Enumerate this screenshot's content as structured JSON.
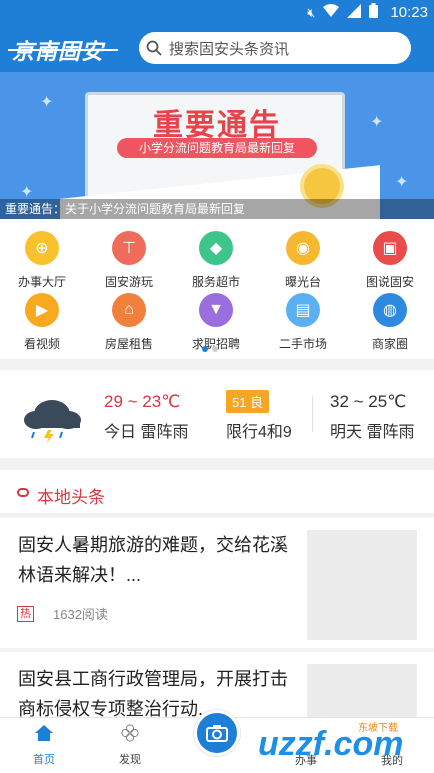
{
  "status": {
    "time": "10:23",
    "icons": [
      "mute-icon",
      "wifi-icon",
      "signal-icon",
      "battery-icon"
    ]
  },
  "header": {
    "logo": "京南固安",
    "search_placeholder": "搜索固安头条资讯"
  },
  "banner": {
    "title": "重要通告",
    "subtitle": "小学分流问题教育局最新回复",
    "caption": "重要通告：关于小学分流问题教育局最新回复"
  },
  "services": [
    {
      "label": "办事大厅",
      "icon": "compass-icon",
      "color": "#f7c22e",
      "glyph": "⊕"
    },
    {
      "label": "固安游玩",
      "icon": "signpost-icon",
      "color": "#ef6b5b",
      "glyph": "⊤"
    },
    {
      "label": "服务超市",
      "icon": "shopping-bag-icon",
      "color": "#3ec58a",
      "glyph": "◆"
    },
    {
      "label": "曝光台",
      "icon": "camera-icon",
      "color": "#f6b830",
      "glyph": "◉"
    },
    {
      "label": "图说固安",
      "icon": "picture-icon",
      "color": "#ea4c4c",
      "glyph": "▣"
    },
    {
      "label": "看视频",
      "icon": "tv-icon",
      "color": "#f8a91f",
      "glyph": "▶"
    },
    {
      "label": "房屋租售",
      "icon": "house-icon",
      "color": "#f2803d",
      "glyph": "⌂"
    },
    {
      "label": "求职招聘",
      "icon": "tie-icon",
      "color": "#9b6ee0",
      "glyph": "▼"
    },
    {
      "label": "二手市场",
      "icon": "shop-icon",
      "color": "#5ab0f2",
      "glyph": "▤"
    },
    {
      "label": "商家圈",
      "icon": "store-icon",
      "color": "#2d8ae0",
      "glyph": "◍"
    }
  ],
  "weather": {
    "icon": "thunderstorm-icon",
    "today_temp": "29 ~ 23℃",
    "today_desc": "今日 雷阵雨",
    "aqi": "51 良",
    "limit": "限行4和9",
    "tomorrow_temp": "32 ~ 25℃",
    "tomorrow_desc": "明天 雷阵雨"
  },
  "news": {
    "section_title": "本地头条",
    "items": [
      {
        "title": "固安人暑期旅游的难题，交给花溪林语来解决！...",
        "tag": "热",
        "reads": "1632阅读"
      },
      {
        "title": "固安县工商行政管理局，开展打击商标侵权专项整治行动..."
      }
    ]
  },
  "bottom_nav": {
    "home": "首页",
    "discover": "发现",
    "affairs": "办事",
    "mine": "我的"
  },
  "watermark": {
    "text": "uzzf.com",
    "sub": "东坡下载"
  },
  "colors": {
    "primary": "#1f7fd6",
    "accent_red": "#d9363e"
  }
}
